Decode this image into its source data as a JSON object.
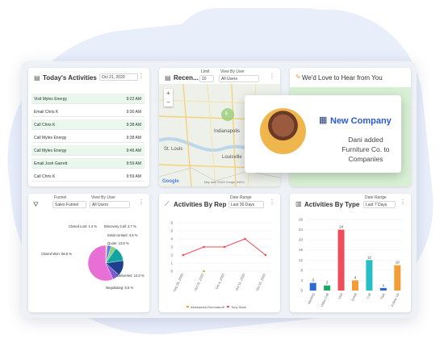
{
  "activities": {
    "title": "Today's Activities",
    "date": "Oct 21, 2020",
    "rows": [
      {
        "name": "Visit Myles Energy",
        "time": "9:22 AM",
        "highlight": true
      },
      {
        "name": "Email Chris K",
        "time": "9:30 AM",
        "highlight": false
      },
      {
        "name": "Call Chris K",
        "time": "9:38 AM",
        "highlight": true
      },
      {
        "name": "Call Myles Energy",
        "time": "9:38 AM",
        "highlight": false
      },
      {
        "name": "Call Myles Energy",
        "time": "9:46 AM",
        "highlight": true
      },
      {
        "name": "Email Josh Garrett",
        "time": "9:59 AM",
        "highlight": true
      },
      {
        "name": "Call Chris K",
        "time": "9:59 AM",
        "highlight": false
      }
    ]
  },
  "recent": {
    "title": "Recen...",
    "limit_label": "Limit",
    "limit_value": "10",
    "viewby_label": "View By User",
    "viewby_value": "All Users",
    "cluster_count": "6",
    "cities": [
      "St. Louis",
      "Indianapolis",
      "Louisville"
    ],
    "map_footer": "Map data ©2020 Google, INEGI",
    "google": "Google"
  },
  "hear": {
    "title": "We'd Love to Hear from You"
  },
  "toast": {
    "company_label": "New Company",
    "text": "Dani added Furniture Co. to Companies"
  },
  "funnel": {
    "funnel_label": "Funnel",
    "funnel_value": "Sales Funnel",
    "viewby_label": "View By User",
    "viewby_value": "All Users"
  },
  "by_rep": {
    "title": "Activities By Rep",
    "range_label": "Date Range",
    "range_value": "Last 30 Days"
  },
  "by_type": {
    "title": "Activities By Type",
    "range_label": "Date Range",
    "range_value": "Last 7 Days"
  },
  "chart_data": [
    {
      "type": "pie",
      "slices": [
        {
          "label": "Closed Lost: 1.4 %",
          "value": 1.4,
          "color": "#f2c94c"
        },
        {
          "label": "Discovery Call: 3.7 %",
          "value": 3.7,
          "color": "#5b7ff2"
        },
        {
          "label": "Initial contact: 4.5 %",
          "value": 4.5,
          "color": "#8bd17c"
        },
        {
          "label": "Quote: 13.0 %",
          "value": 13.0,
          "color": "#12a4a0"
        },
        {
          "label": "Deliveries: 14.0 %",
          "value": 14.0,
          "color": "#1d3f8c"
        },
        {
          "label": "Negotiating: 6.5 %",
          "value": 6.5,
          "color": "#7b5cd6"
        },
        {
          "label": "Closed Won: 56.6 %",
          "value": 56.6,
          "color": "#e86fd6"
        }
      ]
    },
    {
      "type": "line",
      "x": [
        "Sep 28, 2020",
        "Oct 01, 2020",
        "Oct 4, 2020",
        "Oct 11, 2020",
        "Oct 15, 2020"
      ],
      "ylim": [
        0,
        6
      ],
      "yticks": [
        0,
        1,
        2,
        3,
        4,
        5,
        6
      ],
      "series": [
        {
          "name": "Aleksandra Rommanoff",
          "color": "#f0a02e",
          "values": [
            null,
            0,
            null,
            null,
            null
          ]
        },
        {
          "name": "Tony Stark",
          "color": "#ef4d5a",
          "values": [
            2,
            3,
            3,
            4,
            2
          ]
        }
      ]
    },
    {
      "type": "bar",
      "categories": [
        "Meeting",
        "Video Call",
        "Visit",
        "Email",
        "Call",
        "Task",
        "Follow Up"
      ],
      "values": [
        3,
        2,
        24,
        4,
        12,
        1,
        10
      ],
      "colors": [
        "#2d6ad8",
        "#1fa865",
        "#ef4d5a",
        "#f29d38",
        "#26c0c4",
        "#2d6ad8",
        "#f29d38"
      ],
      "ylim": [
        0,
        28
      ],
      "yticks": [
        0,
        4,
        8,
        12,
        16,
        20,
        24,
        28
      ]
    }
  ]
}
